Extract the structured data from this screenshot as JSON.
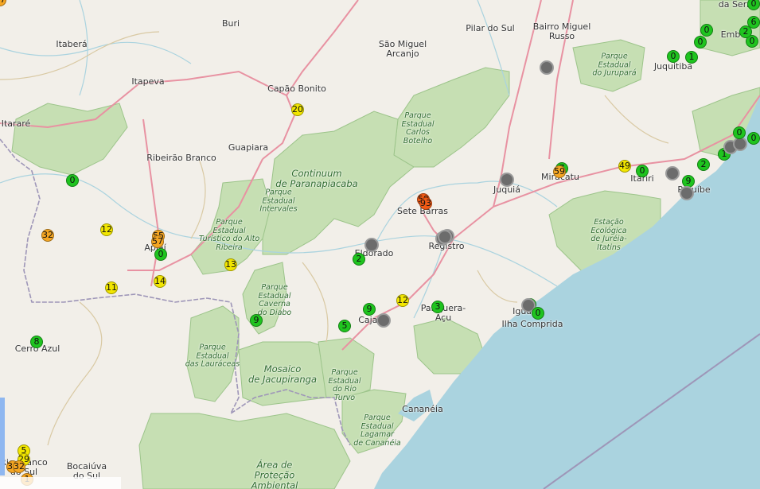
{
  "map": {
    "place_labels": [
      {
        "text": "Itaberá"
      },
      {
        "text": "Buri"
      },
      {
        "text": "Itapeva"
      },
      {
        "text": "Itararé"
      },
      {
        "text": "São Miguel\nArcanjo"
      },
      {
        "text": "Pilar do Sul"
      },
      {
        "text": "Bairro Miguel\nRusso"
      },
      {
        "text": "Capão Bonito"
      },
      {
        "text": "Guapiara"
      },
      {
        "text": "Ribeirão Branco"
      },
      {
        "text": "Juquitiba"
      },
      {
        "text": "da Serra"
      },
      {
        "text": "Emb"
      },
      {
        "text": "Sete Barras"
      },
      {
        "text": "Juquiá"
      },
      {
        "text": "Miracatu"
      },
      {
        "text": "Itariri"
      },
      {
        "text": "Peruíbe"
      },
      {
        "text": "Registro"
      },
      {
        "text": "Eldorado"
      },
      {
        "text": "Pariquera-\nAçu"
      },
      {
        "text": "Iguape"
      },
      {
        "text": "Ilha Comprida"
      },
      {
        "text": "Cananéia"
      },
      {
        "text": "Cajati"
      },
      {
        "text": "Apiaí"
      },
      {
        "text": "Cerro Azul"
      },
      {
        "text": "Bocaiúva\ndo Sul"
      },
      {
        "text": "Rio Branco\ndo Sul"
      }
    ],
    "park_labels": [
      {
        "text": "Parque\nEstadual\nCarlos\nBotelho"
      },
      {
        "text": "Parque\nEstadual\ndo Jurupará"
      },
      {
        "text": "Continuum\nde Paranapiacaba"
      },
      {
        "text": "Parque\nEstadual\nIntervales"
      },
      {
        "text": "Parque\nEstadual\nTurístico do Alto\nRibeira"
      },
      {
        "text": "Parque\nEstadual\nCaverna\ndo Diabo"
      },
      {
        "text": "Parque\nEstadual\ndas Lauráceas"
      },
      {
        "text": "Mosaico\nde Jacupiranga"
      },
      {
        "text": "Parque\nEstadual\ndo Rio\nTurvo"
      },
      {
        "text": "Parque\nEstadual\nLagamar\nde Cananéia"
      },
      {
        "text": "Estação\nEcológica\nde Juréia-\nItatins"
      },
      {
        "text": "Área de\nProteção\nAmbiental"
      }
    ],
    "markers": [
      {
        "value": "0",
        "status": "green"
      },
      {
        "value": "12",
        "status": "yellow"
      },
      {
        "value": "32",
        "status": "orange"
      },
      {
        "value": "55",
        "status": "orange"
      },
      {
        "value": "57",
        "status": "orange"
      },
      {
        "value": "0",
        "status": "green"
      },
      {
        "value": "11",
        "status": "yellow"
      },
      {
        "value": "14",
        "status": "yellow"
      },
      {
        "value": "20",
        "status": "yellow"
      },
      {
        "value": "13",
        "status": "yellow"
      },
      {
        "value": "8",
        "status": "green"
      },
      {
        "value": "9",
        "status": "green"
      },
      {
        "value": "2",
        "status": "green"
      },
      {
        "value": "",
        "status": "gray"
      },
      {
        "value": "59",
        "status": "red"
      },
      {
        "value": "93",
        "status": "red"
      },
      {
        "value": "0",
        "status": "gray"
      },
      {
        "value": "",
        "status": "gray"
      },
      {
        "value": "",
        "status": "gray"
      },
      {
        "value": "9",
        "status": "green"
      },
      {
        "value": "",
        "status": "gray"
      },
      {
        "value": "5",
        "status": "green"
      },
      {
        "value": "12",
        "status": "yellow"
      },
      {
        "value": "3",
        "status": "green"
      },
      {
        "value": "0",
        "status": "green"
      },
      {
        "value": "",
        "status": "gray"
      },
      {
        "value": "0",
        "status": "green"
      },
      {
        "value": "",
        "status": "gray"
      },
      {
        "value": "7",
        "status": "green"
      },
      {
        "value": "59",
        "status": "orange"
      },
      {
        "value": "",
        "status": "gray"
      },
      {
        "value": "49",
        "status": "yellow"
      },
      {
        "value": "0",
        "status": "green"
      },
      {
        "value": "",
        "status": "gray"
      },
      {
        "value": "9",
        "status": "green"
      },
      {
        "value": "",
        "status": "gray"
      },
      {
        "value": "2",
        "status": "green"
      },
      {
        "value": "1",
        "status": "green"
      },
      {
        "value": "",
        "status": "gray"
      },
      {
        "value": "",
        "status": "gray"
      },
      {
        "value": "0",
        "status": "green"
      },
      {
        "value": "0",
        "status": "green"
      },
      {
        "value": "0",
        "status": "green"
      },
      {
        "value": "1",
        "status": "green"
      },
      {
        "value": "0",
        "status": "green"
      },
      {
        "value": "0",
        "status": "green"
      },
      {
        "value": "0",
        "status": "green"
      },
      {
        "value": "6",
        "status": "green"
      },
      {
        "value": "2",
        "status": "green"
      },
      {
        "value": "0",
        "status": "green"
      },
      {
        "value": "5",
        "status": "yellow"
      },
      {
        "value": "29",
        "status": "yellow"
      },
      {
        "value": "34",
        "status": "orange"
      },
      {
        "value": "32",
        "status": "orange"
      },
      {
        "value": "1",
        "status": "orange"
      },
      {
        "value": "47",
        "status": "orange"
      }
    ],
    "colors": {
      "land": "#f2efe9",
      "park": "#c6dfb3",
      "park_border": "#8dbb7a",
      "water": "#aad3df",
      "road_major": "#e892a2",
      "road_minor": "#ffffff",
      "border": "#9e96b8"
    }
  }
}
